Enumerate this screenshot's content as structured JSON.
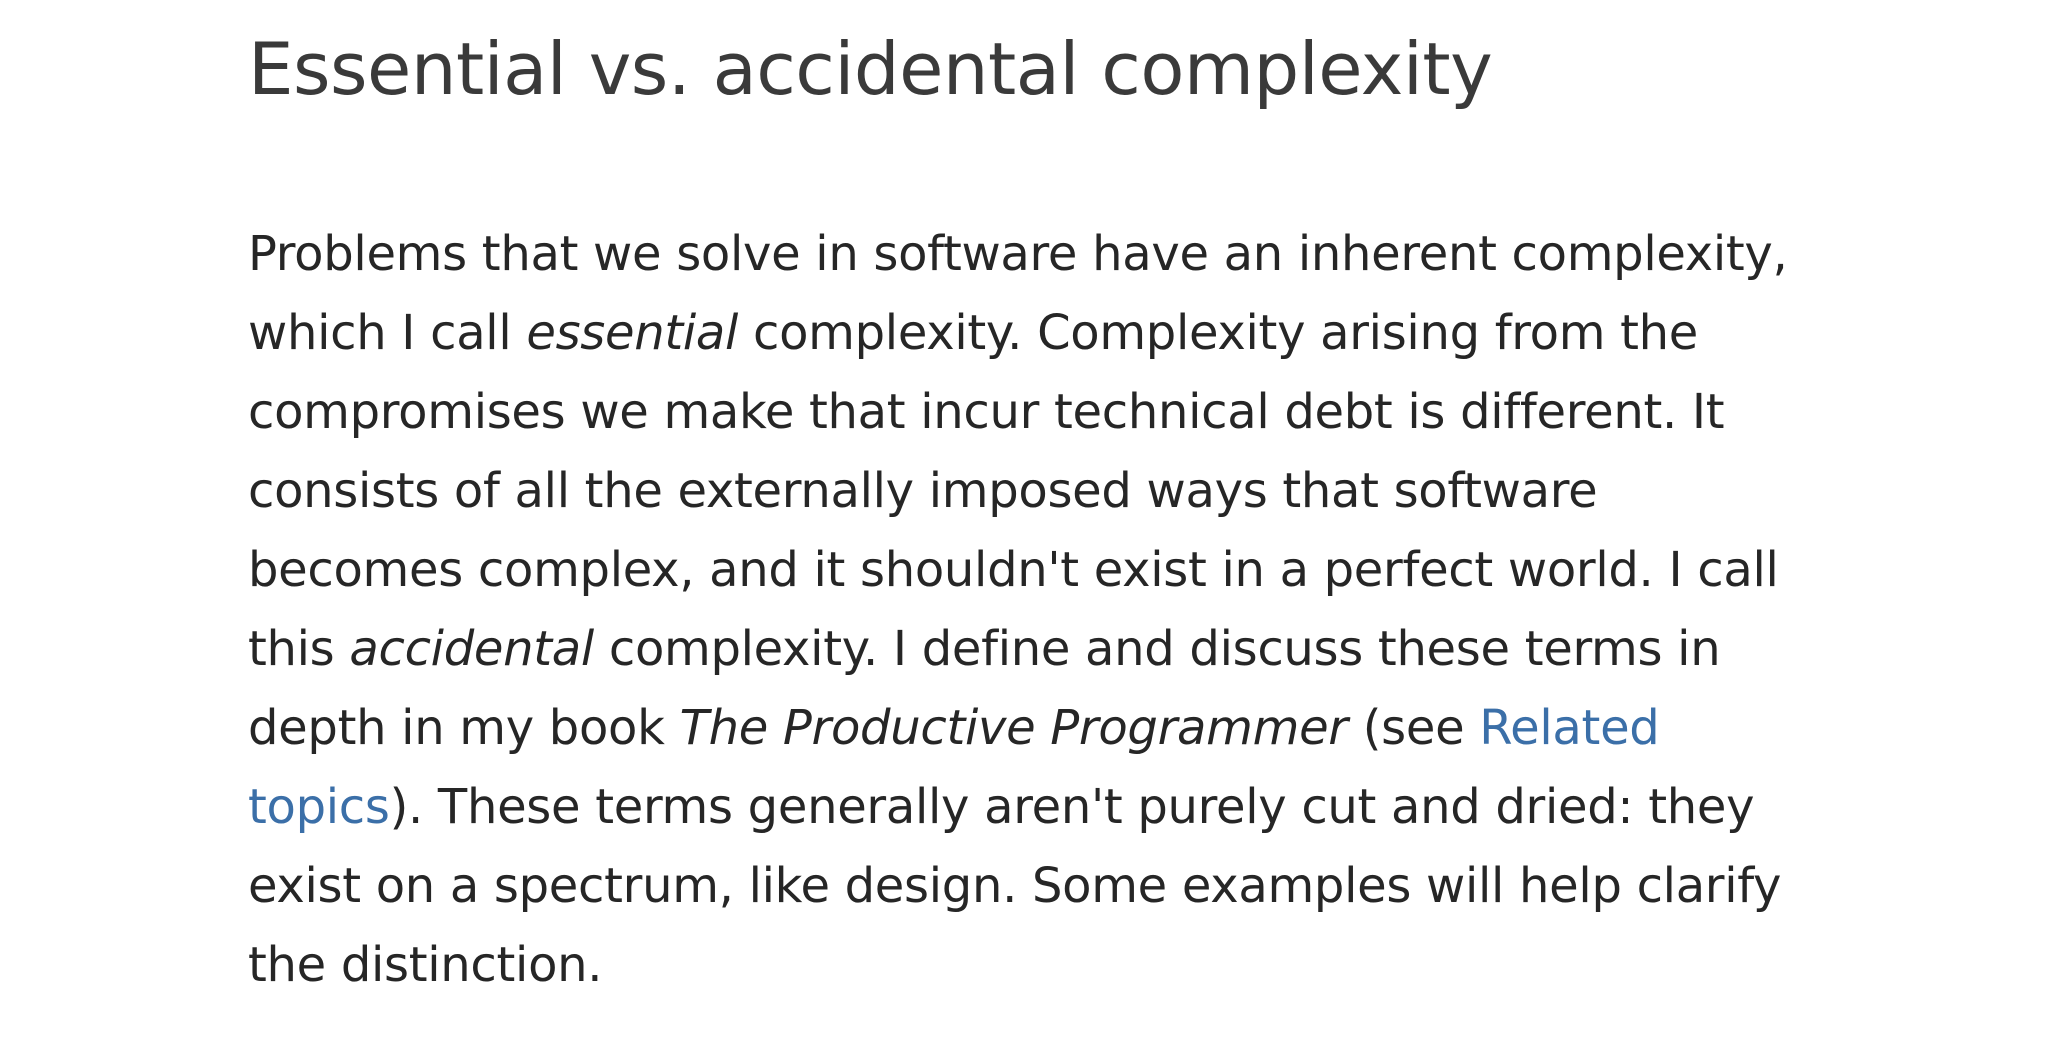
{
  "section": {
    "title": "Essential vs. accidental complexity"
  },
  "paragraph": {
    "line1": "Problems that we solve in software have an inherent complexity,",
    "line2_pre": "which I call ",
    "term_essential": "essential",
    "line2_post": " complexity. Complexity arising from the",
    "line3": "compromises we make that incur technical debt is different. It",
    "line4": "consists of all the externally imposed ways that software",
    "line5": "becomes complex, and it shouldn't exist in a perfect world. I call",
    "line6_pre": "this ",
    "term_accidental": "accidental",
    "line6_post": " complexity. I define and discuss these terms in",
    "line7_pre": "depth in my book ",
    "book_title": "The Productive Programmer",
    "line7_mid": " (see ",
    "link_part1": "Related",
    "link_part2": "topics",
    "line8_post": "). These terms generally aren't purely cut and dried: they",
    "line9": "exist on a spectrum, like design. Some examples will help clarify",
    "line10": "the distinction."
  },
  "colors": {
    "link": "#3b6fa8",
    "heading": "#3a3a3a",
    "text": "#262626"
  }
}
